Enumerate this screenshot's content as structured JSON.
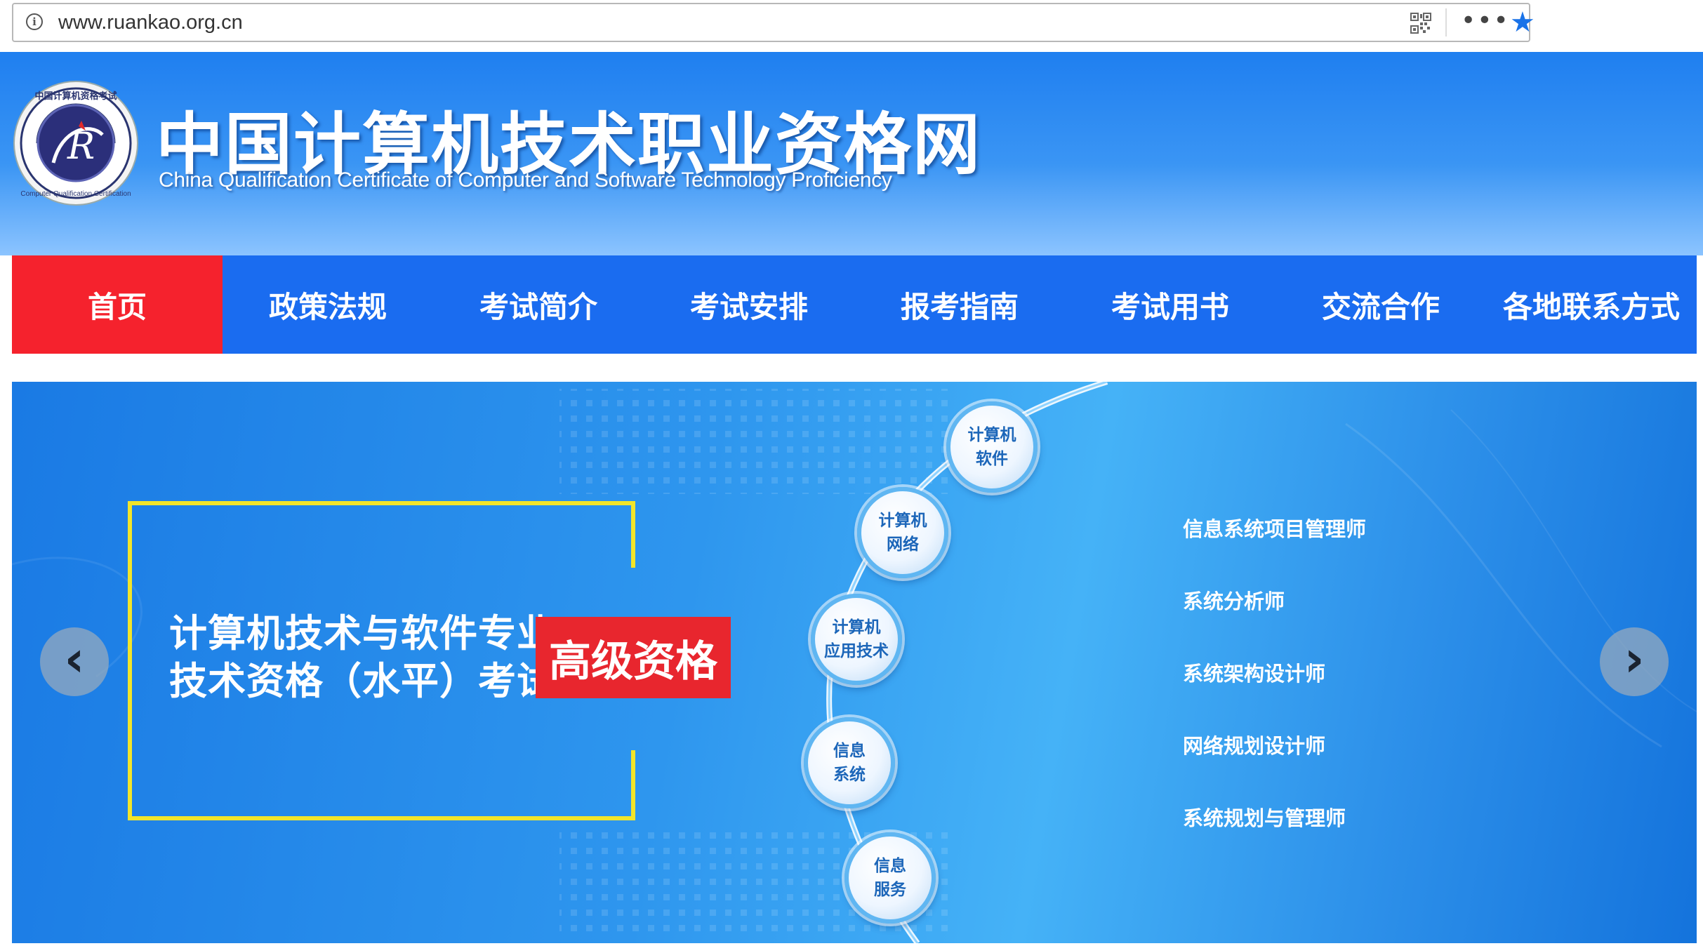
{
  "browser": {
    "url": "www.ruankao.org.cn",
    "info_glyph": "i",
    "more_glyph": "•••",
    "bookmark_glyph": "★"
  },
  "header": {
    "title": "中国计算机技术职业资格网",
    "subtitle": "China Qualification Certificate of Computer and Software Technology Proficiency",
    "logo_text": "中国计算机资格考试 · Computer Qualification Certification"
  },
  "nav": {
    "items": [
      {
        "label": "首页",
        "active": true
      },
      {
        "label": "政策法规"
      },
      {
        "label": "考试简介"
      },
      {
        "label": "考试安排"
      },
      {
        "label": "报考指南"
      },
      {
        "label": "考试用书"
      },
      {
        "label": "交流合作"
      },
      {
        "label": "各地联系方式"
      }
    ]
  },
  "banner": {
    "title_line1": "计算机技术与软件专业",
    "title_line2": "技术资格（水平）考试",
    "level": "高级资格",
    "nodes": [
      {
        "line1": "计算机",
        "line2": "软件"
      },
      {
        "line1": "计算机",
        "line2": "网络"
      },
      {
        "line1": "计算机",
        "line2": "应用技术"
      },
      {
        "line1": "信息",
        "line2": "系统"
      },
      {
        "line1": "信息",
        "line2": "服务"
      }
    ],
    "certs": [
      "信息系统项目管理师",
      "系统分析师",
      "系统架构设计师",
      "网络规划设计师",
      "系统规划与管理师"
    ],
    "prev_glyph": "‹",
    "next_glyph": "›"
  },
  "colors": {
    "nav_bg": "#1a6cf0",
    "nav_active": "#f5222d",
    "header_top": "#1f7ff0",
    "badge_red": "#e8262e",
    "frame_yellow": "#f2e52a",
    "bookmark_blue": "#1a73e8"
  }
}
